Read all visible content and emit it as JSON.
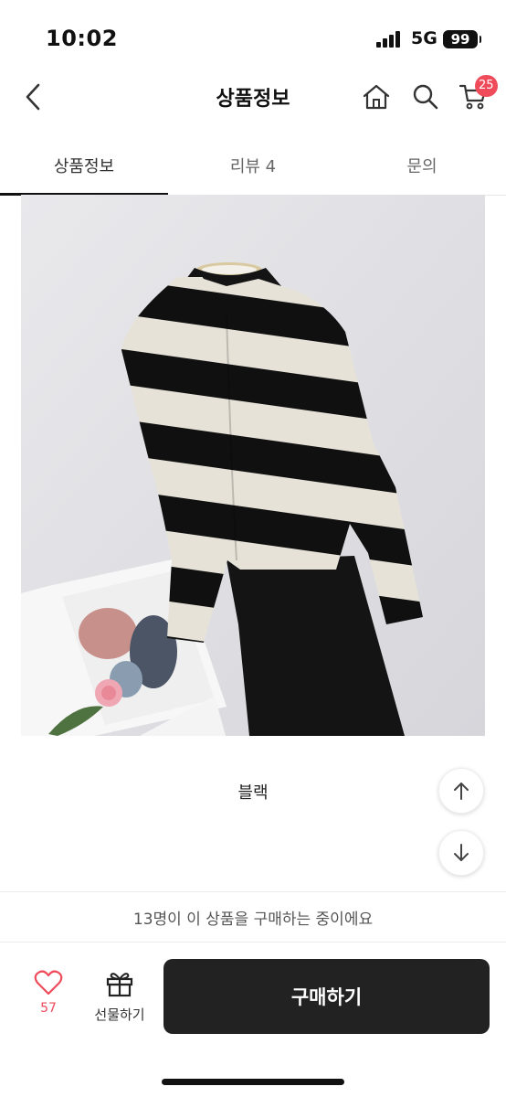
{
  "status_bar": {
    "time": "10:02",
    "network": "5G",
    "battery": "99"
  },
  "header": {
    "title": "상품정보",
    "cart_count": "25",
    "icons": [
      "back-icon",
      "home-icon",
      "search-icon",
      "cart-icon"
    ]
  },
  "tabs": [
    {
      "label": "상품정보",
      "active": true
    },
    {
      "label": "리뷰 4",
      "active": false
    },
    {
      "label": "문의",
      "active": false
    }
  ],
  "product": {
    "option_caption": "블랙"
  },
  "banner": {
    "text": "13명이 이 상품을 구매하는 중이에요"
  },
  "bottom_bar": {
    "like_count": "57",
    "gift_label": "선물하기",
    "buy_label": "구매하기"
  },
  "colors": {
    "accent": "#ef4b5a",
    "buy_button": "#222222",
    "tab_indicator": "#111111"
  }
}
